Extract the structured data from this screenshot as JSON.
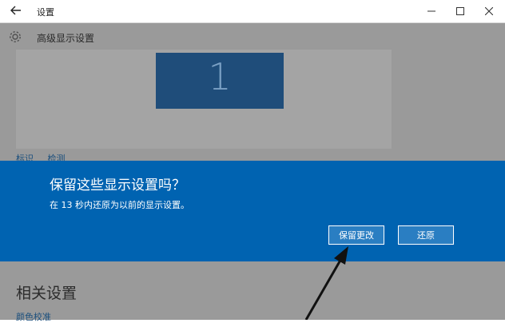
{
  "window": {
    "title": "设置",
    "back_icon": "back-arrow-icon",
    "minimize": "—",
    "close": "✕"
  },
  "header": {
    "title": "高级显示设置",
    "icon": "gear-icon"
  },
  "display": {
    "monitor_number": "1",
    "links": [
      "标识",
      "检测"
    ]
  },
  "dialog": {
    "title": "保留这些显示设置吗？",
    "message": "在 13 秒内还原为以前的显示设置。",
    "keep_button": "保留更改",
    "revert_button": "还原",
    "background_color": "#0063b1"
  },
  "related": {
    "heading": "相关设置",
    "link": "颜色校准"
  }
}
